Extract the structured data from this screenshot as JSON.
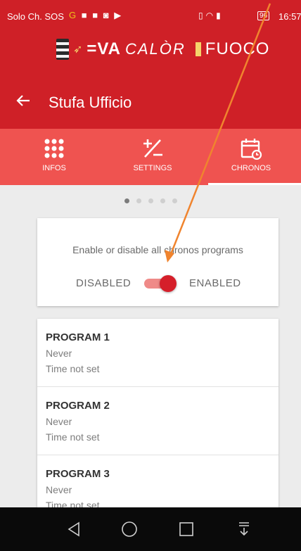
{
  "status_bar": {
    "carrier": "Solo Ch. SOS",
    "battery": "96",
    "time": "16:57"
  },
  "brand": {
    "eva": "=VA",
    "calor": "CALÒR",
    "fuoco": "FUOCO"
  },
  "header": {
    "back_icon": "arrow-left-icon",
    "title": "Stufa Ufficio"
  },
  "tabs": [
    {
      "label": "INFOS",
      "icon": "grid-dots-icon",
      "selected": false
    },
    {
      "label": "SETTINGS",
      "icon": "plus-minus-icon",
      "selected": false
    },
    {
      "label": "CHRONOS",
      "icon": "calendar-clock-icon",
      "selected": true
    }
  ],
  "pager": {
    "pages": 5,
    "active_index": 0
  },
  "chronos_card": {
    "description": "Enable or disable all chronos programs",
    "disabled_label": "DISABLED",
    "enabled_label": "ENABLED",
    "toggle_on": true
  },
  "programs": [
    {
      "name": "PROGRAM 1",
      "days": "Never",
      "time": "Time not set"
    },
    {
      "name": "PROGRAM 2",
      "days": "Never",
      "time": "Time not set"
    },
    {
      "name": "PROGRAM 3",
      "days": "Never",
      "time": "Time not set"
    }
  ],
  "navbar": [
    "back-triangle-icon",
    "home-circle-icon",
    "recents-square-icon",
    "notification-shade-icon"
  ],
  "colors": {
    "primary": "#cf2027",
    "tab_bar": "#ef5350",
    "toggle_thumb": "#d51f2a",
    "toggle_track": "#ef8a88",
    "annotation_arrow": "#f0842e"
  }
}
